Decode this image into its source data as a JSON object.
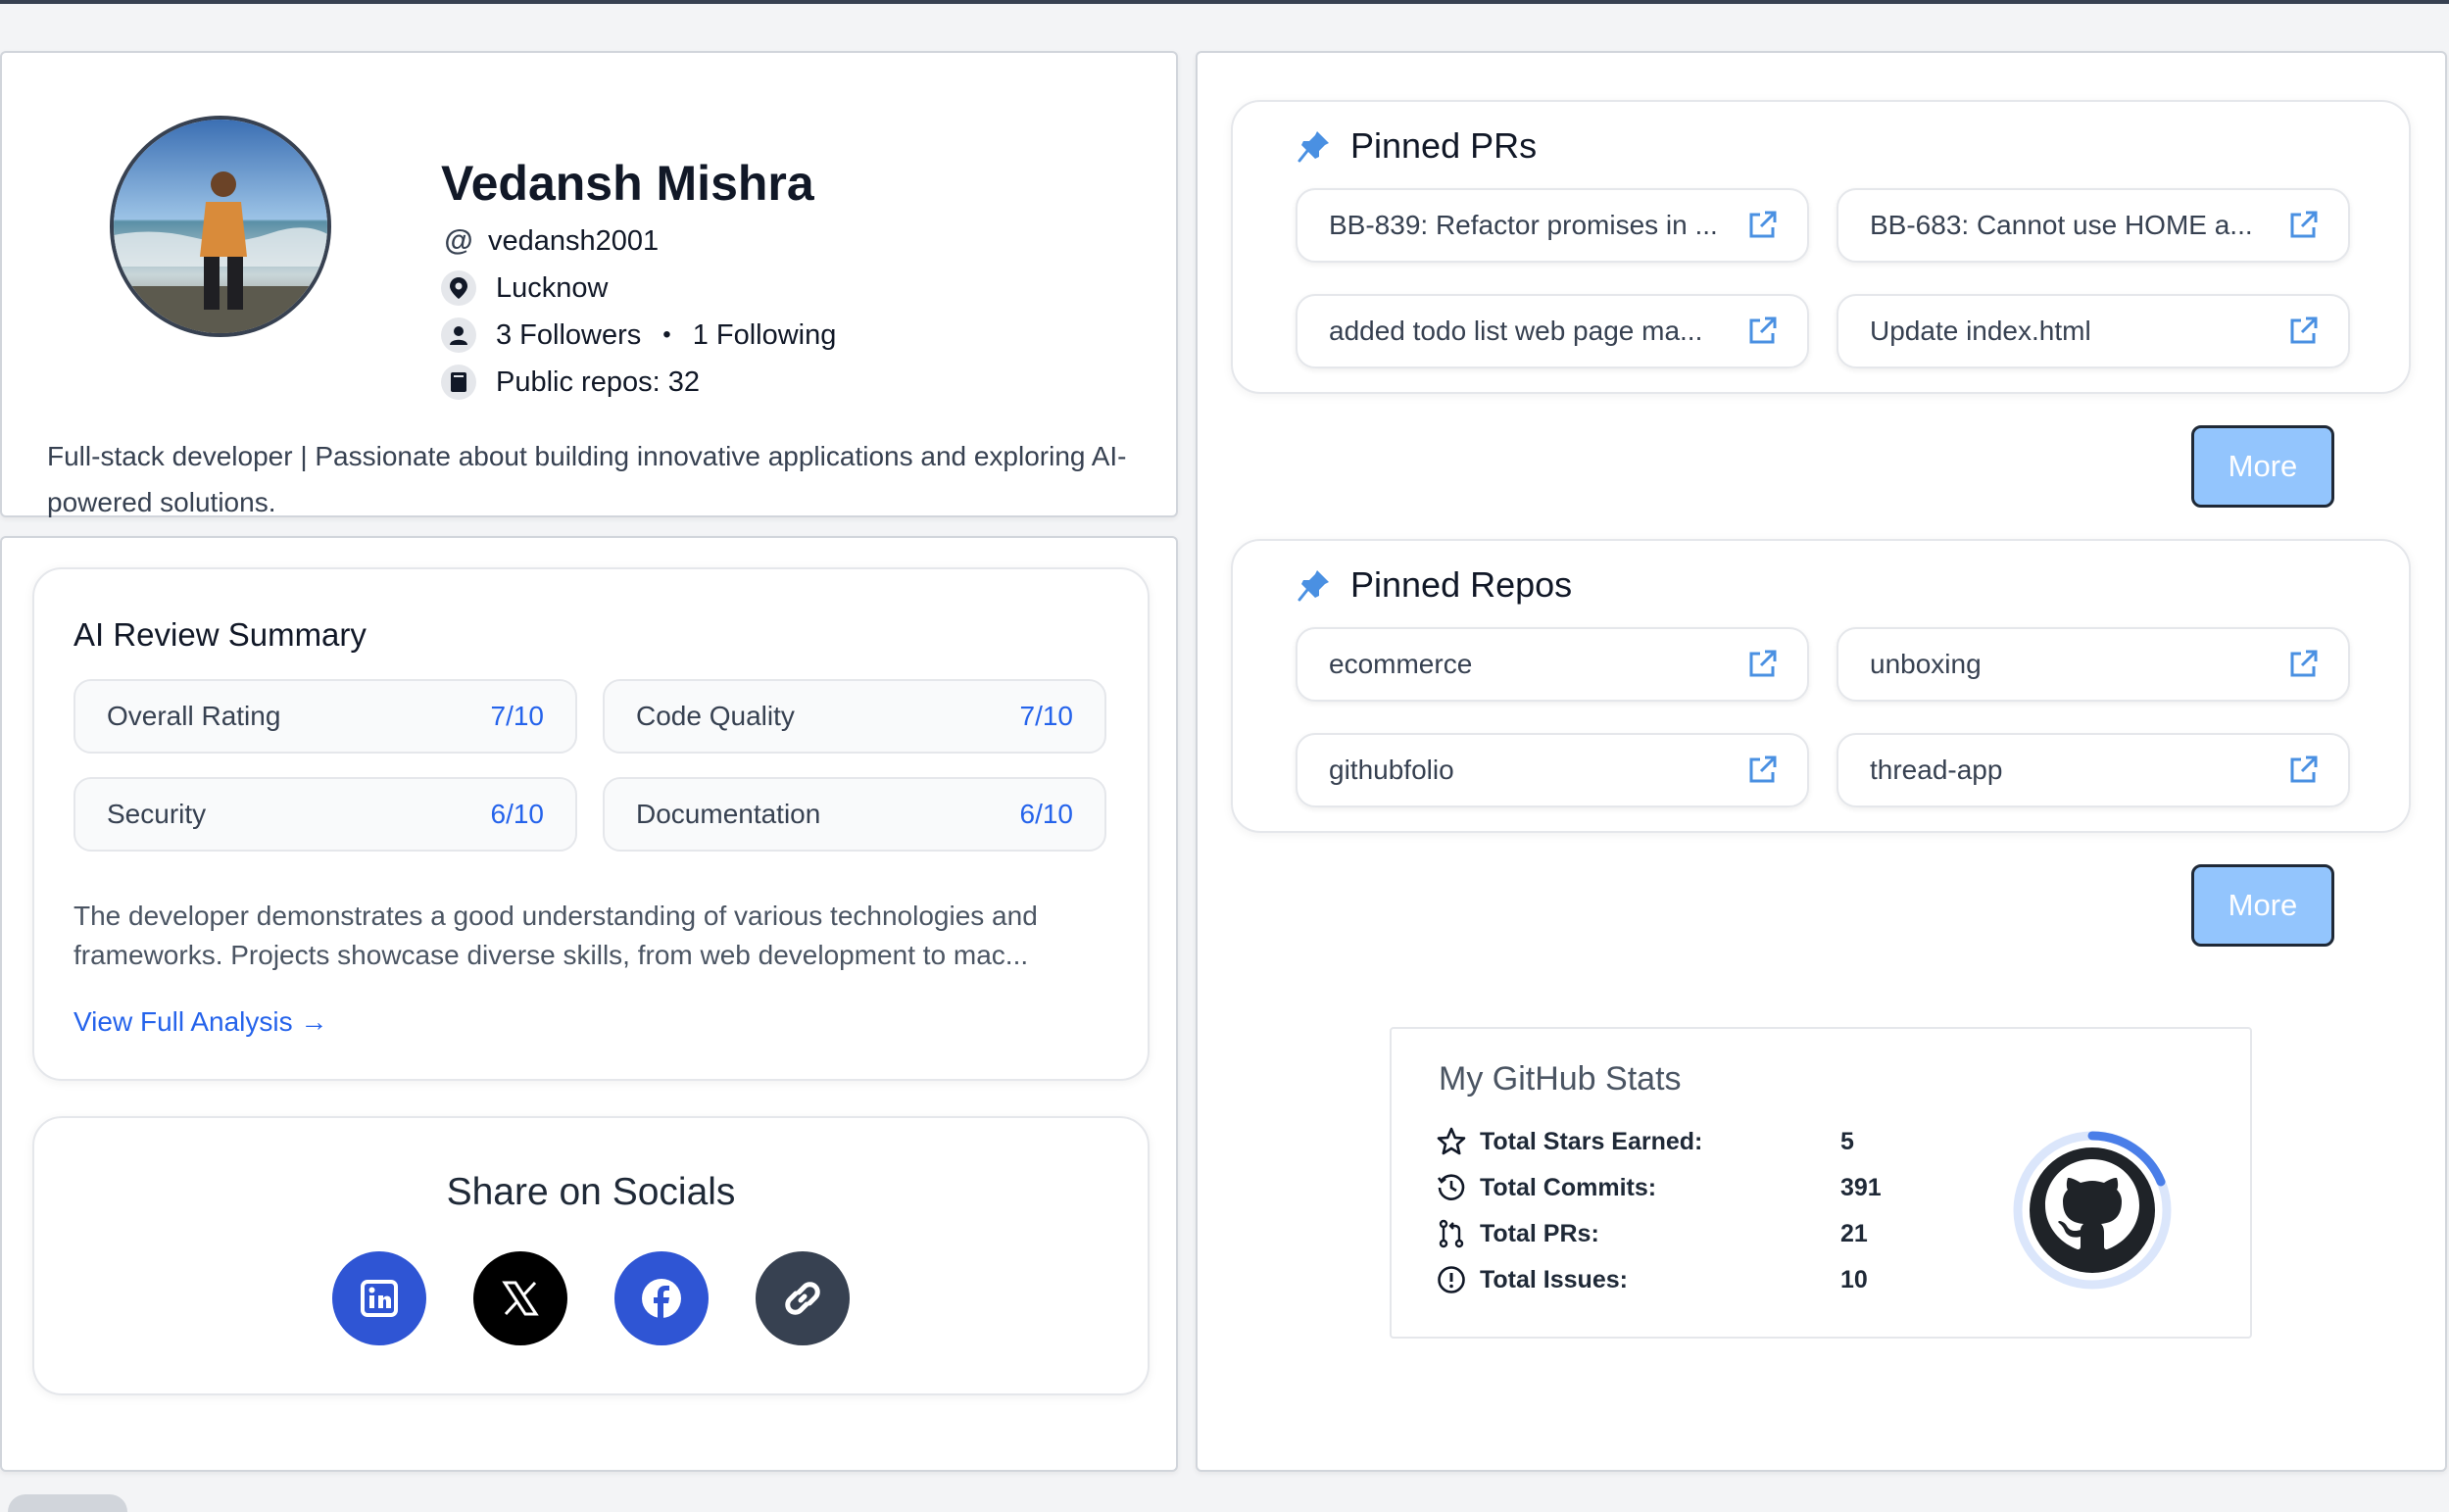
{
  "profile": {
    "name": "Vedansh Mishra",
    "username": "vedansh2001",
    "location": "Lucknow",
    "followers": "3 Followers",
    "following": "1 Following",
    "public_repos": "Public repos: 32",
    "bio": "Full-stack developer | Passionate about building innovative applications and exploring AI-powered solutions."
  },
  "ai_review": {
    "title": "AI Review Summary",
    "metrics": [
      {
        "label": "Overall Rating",
        "value": "7/10"
      },
      {
        "label": "Code Quality",
        "value": "7/10"
      },
      {
        "label": "Security",
        "value": "6/10"
      },
      {
        "label": "Documentation",
        "value": "6/10"
      }
    ],
    "summary": "The developer demonstrates a good understanding of various technologies and frameworks.  Projects showcase diverse skills, from web development to mac...",
    "view_link": "View Full Analysis →"
  },
  "share": {
    "title": "Share on Socials",
    "buttons": [
      {
        "name": "linkedin-icon",
        "color": "#2f55d4"
      },
      {
        "name": "x-icon",
        "color": "#000000"
      },
      {
        "name": "facebook-icon",
        "color": "#2f55d4"
      },
      {
        "name": "link-icon",
        "color": "#374151"
      }
    ]
  },
  "pinned_prs": {
    "title": "Pinned PRs",
    "items": [
      "BB-839: Refactor promises in ...",
      "BB-683: Cannot use HOME a...",
      "added todo list web page ma...",
      "Update index.html"
    ],
    "more_label": "More"
  },
  "pinned_repos": {
    "title": "Pinned Repos",
    "items": [
      "ecommerce",
      "unboxing",
      "githubfolio",
      "thread-app"
    ],
    "more_label": "More"
  },
  "stats": {
    "title": "My GitHub Stats",
    "rows": [
      {
        "icon": "star-icon",
        "label": "Total Stars Earned:",
        "value": "5"
      },
      {
        "icon": "history-icon",
        "label": "Total Commits:",
        "value": "391"
      },
      {
        "icon": "pull-request-icon",
        "label": "Total PRs:",
        "value": "21"
      },
      {
        "icon": "issue-icon",
        "label": "Total Issues:",
        "value": "10"
      }
    ]
  },
  "colors": {
    "accent": "#2563eb",
    "more_button": "#93c5fd",
    "icon_blue": "#4a90e2"
  }
}
